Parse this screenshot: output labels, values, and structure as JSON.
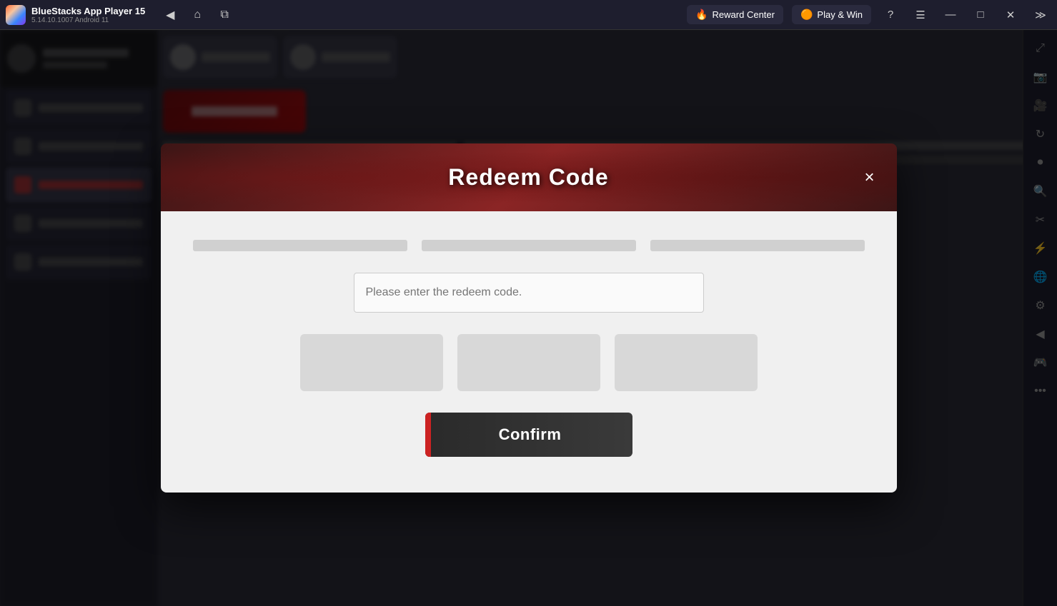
{
  "titleBar": {
    "appName": "BlueStacks App Player 15",
    "version": "5.14.10.1007  Android 11",
    "nav": {
      "back": "◀",
      "home": "⌂",
      "tabs": "⧉"
    },
    "rewardCenter": {
      "icon": "🔥",
      "label": "Reward Center"
    },
    "playWin": {
      "icon": "🟠",
      "label": "Play & Win"
    },
    "actions": {
      "help": "?",
      "menu": "≡",
      "minimize": "—",
      "maximize": "□",
      "close": "✕",
      "expand": "≫"
    }
  },
  "rightSidebar": {
    "icons": [
      {
        "name": "expand-icon",
        "symbol": "⤢"
      },
      {
        "name": "screenshot-icon",
        "symbol": "📷"
      },
      {
        "name": "camera2-icon",
        "symbol": "🎥"
      },
      {
        "name": "refresh-icon",
        "symbol": "↻"
      },
      {
        "name": "record-icon",
        "symbol": "⏺"
      },
      {
        "name": "zoom-icon",
        "symbol": "🔍"
      },
      {
        "name": "crop-icon",
        "symbol": "✂"
      },
      {
        "name": "macro-icon",
        "symbol": "⚡"
      },
      {
        "name": "globe-icon",
        "symbol": "🌐"
      },
      {
        "name": "settings-icon",
        "symbol": "⚙"
      },
      {
        "name": "back-arrow-icon",
        "symbol": "◀"
      },
      {
        "name": "controller-icon",
        "symbol": "🎮"
      },
      {
        "name": "dots-icon",
        "symbol": "•••"
      }
    ]
  },
  "modal": {
    "title": "Redeem Code",
    "closeBtn": "×",
    "inputPlaceholder": "Please enter the redeem code.",
    "confirmLabel": "Confirm"
  }
}
